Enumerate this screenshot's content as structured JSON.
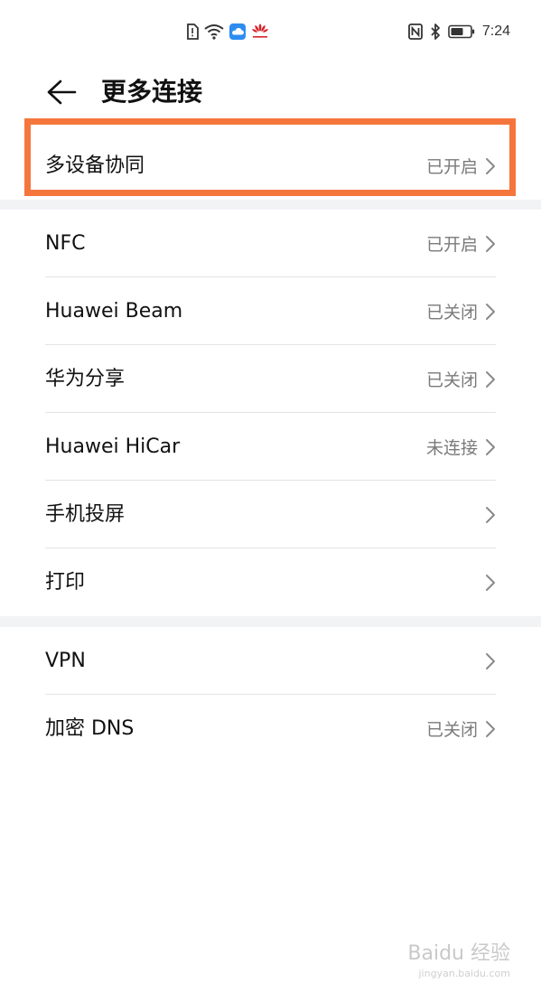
{
  "status_bar": {
    "time": "7:24",
    "left_icons": [
      "sim-alert-icon",
      "wifi-icon",
      "cloud-app-icon",
      "huawei-logo-icon"
    ],
    "right_icons": [
      "nfc-icon",
      "bluetooth-icon",
      "battery-icon"
    ]
  },
  "header": {
    "title": "更多连接"
  },
  "section1": {
    "items": [
      {
        "label": "多设备协同",
        "value": "已开启"
      }
    ]
  },
  "section2": {
    "items": [
      {
        "label": "NFC",
        "value": "已开启"
      },
      {
        "label": "Huawei Beam",
        "value": "已关闭"
      },
      {
        "label": "华为分享",
        "value": "已关闭"
      },
      {
        "label": "Huawei HiCar",
        "value": "未连接"
      },
      {
        "label": "手机投屏",
        "value": ""
      },
      {
        "label": "打印",
        "value": ""
      }
    ]
  },
  "section3": {
    "items": [
      {
        "label": "VPN",
        "value": ""
      },
      {
        "label": "加密 DNS",
        "value": "已关闭"
      }
    ]
  },
  "watermark": {
    "text": "Baidu 经验",
    "sub": "jingyan.baidu.com"
  },
  "colors": {
    "highlight": "#f5763c",
    "gap": "#f1f3f5",
    "value_text": "#7a7a7a"
  }
}
